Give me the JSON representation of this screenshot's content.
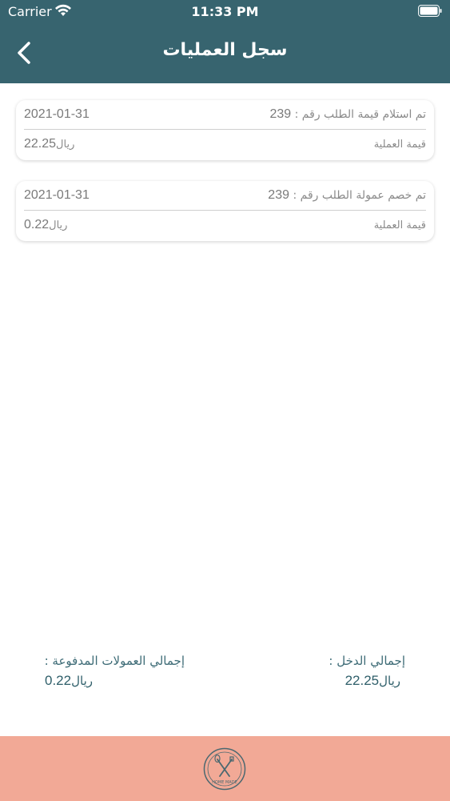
{
  "status_bar": {
    "carrier": "Carrier",
    "time": "11:33 PM"
  },
  "header": {
    "title": "سجل العمليات"
  },
  "transactions": [
    {
      "date": "2021-01-31",
      "description": "تم استلام قيمة الطلب رقم :",
      "order_number": "239",
      "operation_label": "قيمة العملية",
      "amount": "22.25",
      "currency": "ريال"
    },
    {
      "date": "2021-01-31",
      "description": "تم خصم عمولة الطلب رقم :",
      "order_number": "239",
      "operation_label": "قيمة العملية",
      "amount": "0.22",
      "currency": "ريال"
    }
  ],
  "totals": {
    "income_label": "إجمالي الدخل :",
    "income_amount": "22.25",
    "commission_label": "إجمالي العمولات المدفوعة :",
    "commission_amount": "0.22",
    "currency": "ريال"
  },
  "footer": {
    "logo_text": "HOME MADE"
  },
  "colors": {
    "header": "#37646f",
    "footer": "#f2a996",
    "accent_text": "#3d6b76"
  }
}
